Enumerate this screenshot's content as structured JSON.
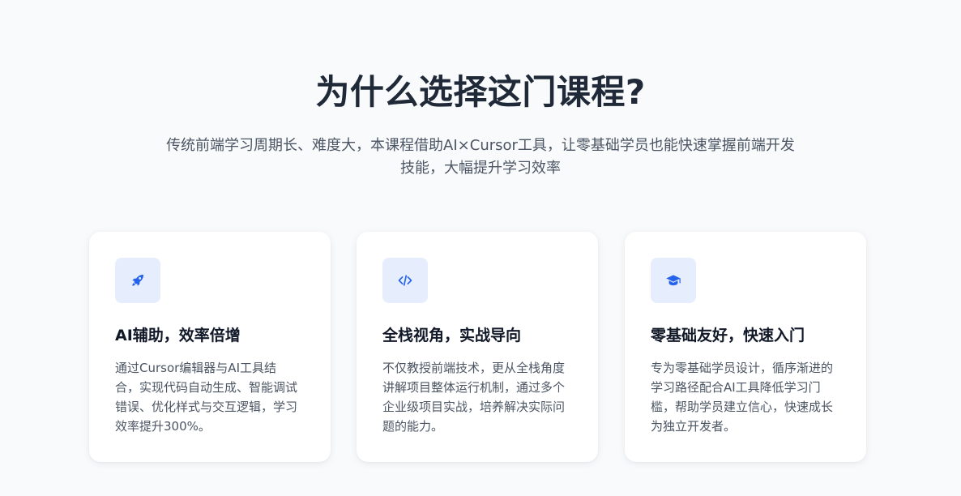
{
  "section": {
    "title": "为什么选择这门课程?",
    "subtitle": "传统前端学习周期长、难度大，本课程借助AI×Cursor工具，让零基础学员也能快速掌握前端开发技能，大幅提升学习效率"
  },
  "accent_color": "#2563eb",
  "icon_background": "#e6eefe",
  "cards": [
    {
      "icon": "rocket-icon",
      "title": "AI辅助，效率倍增",
      "description": "通过Cursor编辑器与AI工具结合，实现代码自动生成、智能调试错误、优化样式与交互逻辑，学习效率提升300%。"
    },
    {
      "icon": "code-icon",
      "title": "全栈视角，实战导向",
      "description": "不仅教授前端技术，更从全栈角度讲解项目整体运行机制，通过多个企业级项目实战，培养解决实际问题的能力。"
    },
    {
      "icon": "graduation-cap-icon",
      "title": "零基础友好，快速入门",
      "description": "专为零基础学员设计，循序渐进的学习路径配合AI工具降低学习门槛，帮助学员建立信心，快速成长为独立开发者。"
    }
  ]
}
